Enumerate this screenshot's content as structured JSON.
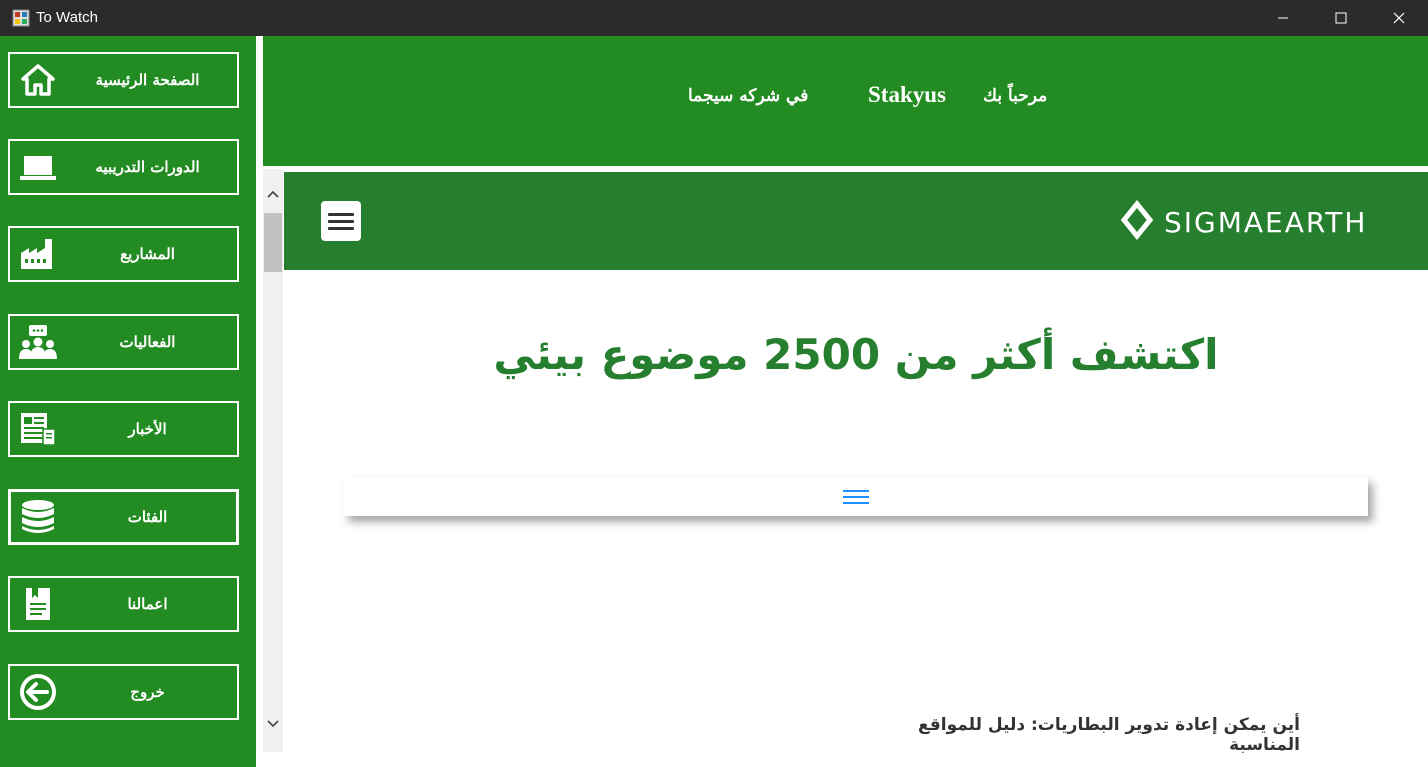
{
  "window": {
    "title": "To Watch",
    "controls": {
      "minimize": "minimize-icon",
      "maximize": "maximize-icon",
      "close": "close-icon"
    }
  },
  "sidebar": {
    "items": [
      {
        "label": "الصفحة الرئيسية",
        "icon": "home-icon"
      },
      {
        "label": "الدورات التدريبيه",
        "icon": "laptop-icon"
      },
      {
        "label": "المشاريع",
        "icon": "factory-icon"
      },
      {
        "label": "الفعاليات",
        "icon": "audience-icon"
      },
      {
        "label": "الأخبار",
        "icon": "newspaper-icon"
      },
      {
        "label": "الفئات",
        "icon": "database-icon"
      },
      {
        "label": "اعمالنا",
        "icon": "document-icon"
      },
      {
        "label": "خروج",
        "icon": "exit-arrow-icon"
      }
    ],
    "active_index": 5
  },
  "header": {
    "welcome": "مرحباً بك",
    "username": "Stakyus",
    "company": "في شركه سيجما"
  },
  "web": {
    "logo_text": "SIGMAEARTH",
    "hero_title": "اكتشف أكثر من 2500 موضوع بيئي",
    "article_title": "أين يمكن إعادة تدوير البطاريات: دليل للمواقع المناسبة"
  },
  "colors": {
    "sidebar_green": "#228b22",
    "web_nav_green": "#267f2e",
    "menu_icon_blue": "#1e90ff"
  }
}
